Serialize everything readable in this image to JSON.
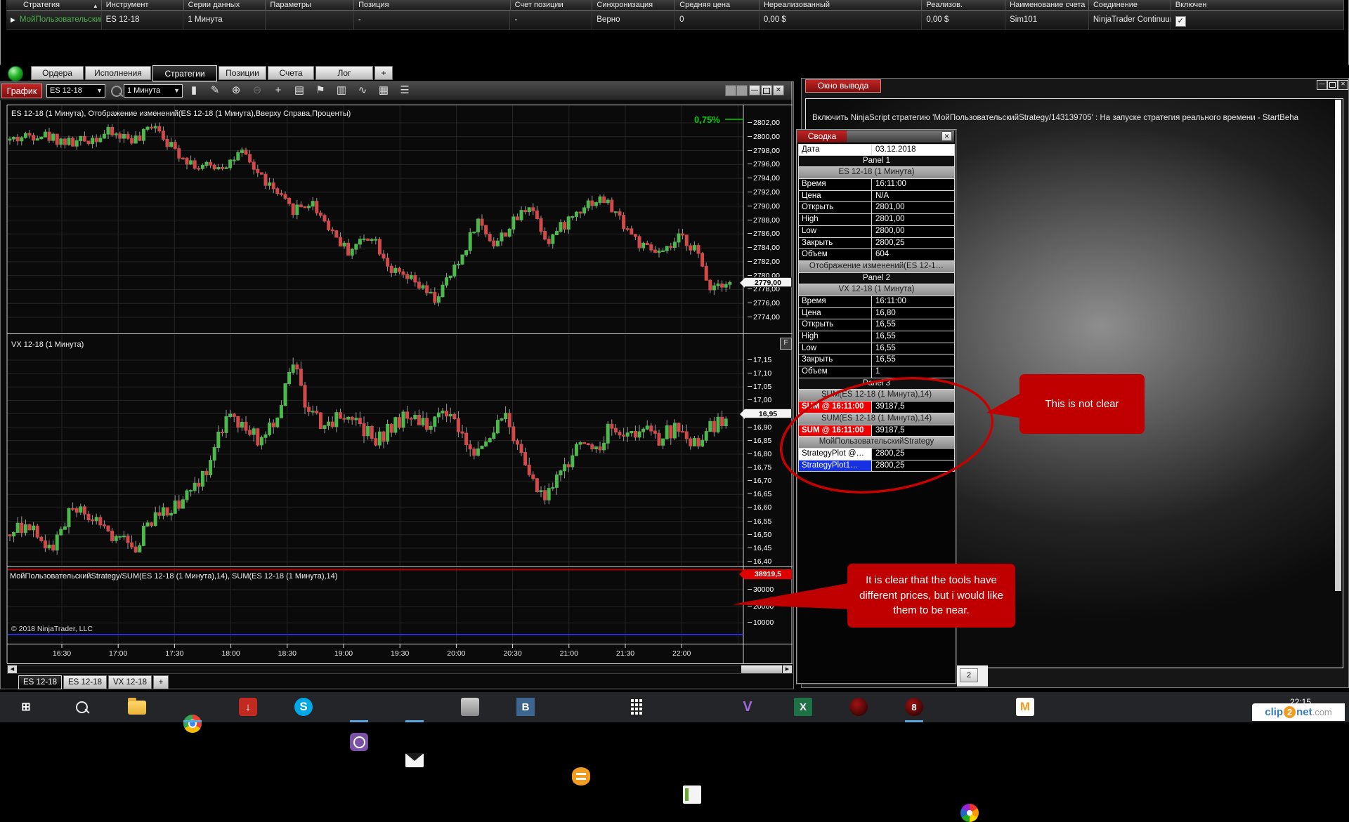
{
  "icons": {
    "sort": "▲",
    "row_marker": "▶",
    "check": "✓",
    "close": "✕",
    "minimize": "—",
    "dropdown": "▼",
    "scroll_left": "◀",
    "scroll_right": "▶"
  },
  "strategies_grid": {
    "columns": [
      "Стратегия",
      "Инструмент",
      "Серии данных",
      "Параметры",
      "Позиция",
      "Счет позиции",
      "Синхронизация",
      "Средняя цена",
      "Нереализованный",
      "Реализов.",
      "Наименование счета",
      "Соединение",
      "Включен"
    ],
    "row": [
      "МойПользовательский:",
      "ES 12-18",
      "1 Минута",
      "",
      "-",
      "-",
      "Верно",
      "0",
      "0,00 $",
      "0,00 $",
      "Sim101",
      "NinjaTrader Continuum",
      "✓"
    ]
  },
  "tabbar": {
    "tabs": [
      "Ордера",
      "Исполнения",
      "Стратегии",
      "Позиции",
      "Счета",
      "Лог",
      "+"
    ],
    "active": "Стратегии"
  },
  "chart": {
    "title": "График",
    "instrument": "ES 12-18",
    "interval": "1 Минута",
    "toolbar_icons": [
      {
        "name": "candlestick-icon",
        "glyph": "▮"
      },
      {
        "name": "pencil-icon",
        "glyph": "✎"
      },
      {
        "name": "zoom-in-icon",
        "glyph": "⊕"
      },
      {
        "name": "zoom-out-icon",
        "glyph": "⊖",
        "dim": true
      },
      {
        "name": "crosshair-icon",
        "glyph": "+"
      },
      {
        "name": "script-icon",
        "glyph": "▤"
      },
      {
        "name": "flag-icon",
        "glyph": "⚑"
      },
      {
        "name": "bars-icon",
        "glyph": "▥"
      },
      {
        "name": "wave-icon",
        "glyph": "∿"
      },
      {
        "name": "grid-icon",
        "glyph": "▦"
      },
      {
        "name": "list-icon",
        "glyph": "☰"
      }
    ],
    "panel1_label": "ES 12-18 (1 Минута), Отображение изменений(ES 12-18 (1 Минута),Вверху Справа,Проценты)",
    "percent_label": "0,75%",
    "panel2_label": "VX 12-18 (1 Минута)",
    "panel2_button": "F",
    "panel3_label": "МойПользовательскийStrategy/SUM(ES 12-18 (1 Минута),14), SUM(ES 12-18 (1 Минута),14)",
    "copyright": "© 2018 NinjaTrader, LLC",
    "es_ticks": [
      "2802,00",
      "2800,00",
      "2798,00",
      "2796,00",
      "2794,00",
      "2792,00",
      "2790,00",
      "2788,00",
      "2786,00",
      "2784,00",
      "2782,00",
      "2780,00",
      "2778,00",
      "2776,00",
      "2774,00"
    ],
    "es_marker": "2779,00",
    "vx_ticks": [
      "17,15",
      "17,10",
      "17,05",
      "17,00",
      "16,95",
      "16,90",
      "16,85",
      "16,80",
      "16,75",
      "16,70",
      "16,65",
      "16,60",
      "16,55",
      "16,50",
      "16,45",
      "16,40"
    ],
    "vx_marker": "16,95",
    "p3_ticks": [
      "30000",
      "20000",
      "10000"
    ],
    "p3_marker": "38919,5",
    "time_ticks": [
      "16:30",
      "17:00",
      "17:30",
      "18:00",
      "18:30",
      "19:00",
      "19:30",
      "20:00",
      "20:30",
      "21:00",
      "21:30",
      "22:00"
    ],
    "bottom_tabs": [
      "ES 12-18",
      "ES 12-18",
      "VX 12-18",
      "+"
    ],
    "bottom_tabs_active": "ES 12-18"
  },
  "chart_data": [
    {
      "type": "candlestick",
      "name": "ES 12-18 (1 Минута)",
      "panel": 1,
      "y_axis": {
        "ticks": [
          2802,
          2800,
          2798,
          2796,
          2794,
          2792,
          2790,
          2788,
          2786,
          2784,
          2782,
          2780,
          2778,
          2776,
          2774
        ],
        "last_price": 2779.0
      },
      "anchors": [
        [
          0,
          2799.5
        ],
        [
          40,
          2800.5
        ],
        [
          90,
          2799
        ],
        [
          140,
          2800.5
        ],
        [
          185,
          2799.5
        ],
        [
          205,
          2802.3
        ],
        [
          230,
          2798.5
        ],
        [
          270,
          2795.5
        ],
        [
          305,
          2796
        ],
        [
          330,
          2797.5
        ],
        [
          360,
          2794
        ],
        [
          400,
          2789.5
        ],
        [
          430,
          2790.5
        ],
        [
          455,
          2787
        ],
        [
          480,
          2783.5
        ],
        [
          515,
          2786
        ],
        [
          545,
          2780.5
        ],
        [
          575,
          2779
        ],
        [
          605,
          2776.5
        ],
        [
          640,
          2782
        ],
        [
          665,
          2788
        ],
        [
          690,
          2784.5
        ],
        [
          720,
          2788
        ],
        [
          740,
          2790.5
        ],
        [
          765,
          2785
        ],
        [
          790,
          2787.5
        ],
        [
          820,
          2790.5
        ],
        [
          845,
          2791
        ],
        [
          870,
          2788
        ],
        [
          900,
          2784
        ],
        [
          930,
          2783
        ],
        [
          955,
          2785.5
        ],
        [
          975,
          2784
        ],
        [
          995,
          2778.5
        ],
        [
          1015,
          2779.2
        ],
        [
          1030,
          2779
        ]
      ],
      "up_color": "#4db84d",
      "down_color": "#d24949",
      "change_display_pct": "0,75%"
    },
    {
      "type": "candlestick",
      "name": "VX 12-18 (1 Минута)",
      "panel": 2,
      "y_axis": {
        "ticks": [
          17.15,
          17.1,
          17.05,
          17.0,
          16.95,
          16.9,
          16.85,
          16.8,
          16.75,
          16.7,
          16.65,
          16.6,
          16.55,
          16.5,
          16.45,
          16.4
        ],
        "last_price": 16.95
      },
      "anchors": [
        [
          0,
          16.5
        ],
        [
          30,
          16.55
        ],
        [
          60,
          16.45
        ],
        [
          90,
          16.6
        ],
        [
          120,
          16.55
        ],
        [
          150,
          16.5
        ],
        [
          175,
          16.45
        ],
        [
          200,
          16.55
        ],
        [
          230,
          16.6
        ],
        [
          260,
          16.65
        ],
        [
          290,
          16.8
        ],
        [
          310,
          16.95
        ],
        [
          330,
          16.9
        ],
        [
          355,
          16.85
        ],
        [
          380,
          16.95
        ],
        [
          405,
          17.13
        ],
        [
          425,
          16.95
        ],
        [
          450,
          16.9
        ],
        [
          475,
          16.95
        ],
        [
          500,
          16.9
        ],
        [
          520,
          16.85
        ],
        [
          545,
          16.9
        ],
        [
          570,
          16.95
        ],
        [
          590,
          16.9
        ],
        [
          615,
          16.95
        ],
        [
          640,
          16.9
        ],
        [
          655,
          16.8
        ],
        [
          675,
          16.85
        ],
        [
          700,
          16.95
        ],
        [
          720,
          16.85
        ],
        [
          745,
          16.7
        ],
        [
          765,
          16.65
        ],
        [
          790,
          16.75
        ],
        [
          815,
          16.85
        ],
        [
          835,
          16.8
        ],
        [
          855,
          16.9
        ],
        [
          880,
          16.85
        ],
        [
          900,
          16.9
        ],
        [
          920,
          16.85
        ],
        [
          950,
          16.9
        ],
        [
          975,
          16.85
        ],
        [
          1000,
          16.9
        ],
        [
          1020,
          16.95
        ]
      ],
      "up_color": "#4db84d",
      "down_color": "#d24949"
    },
    {
      "type": "line",
      "name": "SUM(ES 12-18 (1 Минута),14)",
      "panel": 3,
      "value": 38919.5,
      "color": "#b00000"
    },
    {
      "type": "line",
      "name": "МойПользовательскийStrategy StrategyPlot",
      "panel": 3,
      "value": 2800.25,
      "color": "#2a2ad0"
    },
    {
      "x_axis": {
        "ticks": [
          "16:30",
          "17:00",
          "17:30",
          "18:00",
          "18:30",
          "19:00",
          "19:30",
          "20:00",
          "20:30",
          "21:00",
          "21:30",
          "22:00"
        ]
      }
    }
  ],
  "summary": {
    "title": "Сводка",
    "rows": [
      [
        "kvw",
        "Дата",
        "03.12.2018"
      ],
      [
        "sec",
        "Panel 1"
      ],
      [
        "sub",
        "ES 12-18 (1 Минута)"
      ],
      [
        "kv",
        "Время",
        "16:11:00"
      ],
      [
        "kv",
        "Цена",
        "N/A"
      ],
      [
        "kv",
        "Открыть",
        "2801,00"
      ],
      [
        "kv",
        "High",
        "2801,00"
      ],
      [
        "kv",
        "Low",
        "2800,00"
      ],
      [
        "kv",
        "Закрыть",
        "2800,25"
      ],
      [
        "kv",
        "Объем",
        "604"
      ],
      [
        "sub",
        "Отображение изменений(ES 12-1…"
      ],
      [
        "sec",
        "Panel 2"
      ],
      [
        "sub",
        "VX 12-18 (1 Минута)"
      ],
      [
        "kv",
        "Время",
        "16:11:00"
      ],
      [
        "kv",
        "Цена",
        "16,80"
      ],
      [
        "kv",
        "Открыть",
        "16,55"
      ],
      [
        "kv",
        "High",
        "16,55"
      ],
      [
        "kv",
        "Low",
        "16,55"
      ],
      [
        "kv",
        "Закрыть",
        "16,55"
      ],
      [
        "kv",
        "Объем",
        "1"
      ],
      [
        "sec",
        "Panel 3"
      ],
      [
        "sub",
        "SUM(ES 12-18 (1 Минута),14)"
      ],
      [
        "kvr",
        "SUM @ 16:11:00",
        "39187,5"
      ],
      [
        "sub",
        "SUM(ES 12-18 (1 Минута),14)"
      ],
      [
        "kvr",
        "SUM @ 16:11:00",
        "39187,5"
      ],
      [
        "sub",
        "МойПользовательскийStrategy"
      ],
      [
        "kvwk",
        "StrategyPlot @…",
        "2800,25"
      ],
      [
        "kvbk",
        "StrategyPlot1…",
        "2800,25"
      ]
    ]
  },
  "output_window": {
    "title": "Окно вывода",
    "log_line": "Включить NinjaScript стратегию 'МойПользовательскийStrategy/143139705' : На запуске стратегия реального времени - StartBeha",
    "bottom_tab": "2"
  },
  "annotations": {
    "callout1": "This is not clear",
    "callout2": "It is clear that the tools have different prices, but i would like them to be near.",
    "accent_color": "#c00000"
  },
  "taskbar": {
    "time": "22:15",
    "icons": [
      {
        "name": "windows-start-icon",
        "glyph": "⊞"
      },
      {
        "name": "search-icon",
        "glyph": ""
      },
      {
        "name": "explorer-icon",
        "glyph": ""
      },
      {
        "name": "chrome-icon",
        "glyph": "",
        "active": true
      },
      {
        "name": "download-icon",
        "glyph": "↓"
      },
      {
        "name": "skype-icon",
        "glyph": "S"
      },
      {
        "name": "viber-icon",
        "glyph": "",
        "active": true
      },
      {
        "name": "mail-icon",
        "glyph": "",
        "active": true
      },
      {
        "name": "fax-icon",
        "glyph": ""
      },
      {
        "name": "bitrix-icon",
        "glyph": "B"
      },
      {
        "name": "orange-icon",
        "glyph": ""
      },
      {
        "name": "calculator-icon",
        "glyph": ""
      },
      {
        "name": "notes-icon",
        "glyph": ""
      },
      {
        "name": "visual-studio-icon",
        "glyph": "V"
      },
      {
        "name": "excel-icon",
        "glyph": "X"
      },
      {
        "name": "ninjatrader-icon",
        "glyph": ""
      },
      {
        "name": "ninjatrader8-icon",
        "glyph": "8",
        "active": true
      },
      {
        "name": "pinwheel-icon",
        "glyph": ""
      },
      {
        "name": "mail-ru-icon",
        "glyph": "M"
      }
    ],
    "watermark": {
      "p1": "clip",
      "p2": "2",
      "p3": "net",
      "p4": ".com"
    }
  }
}
